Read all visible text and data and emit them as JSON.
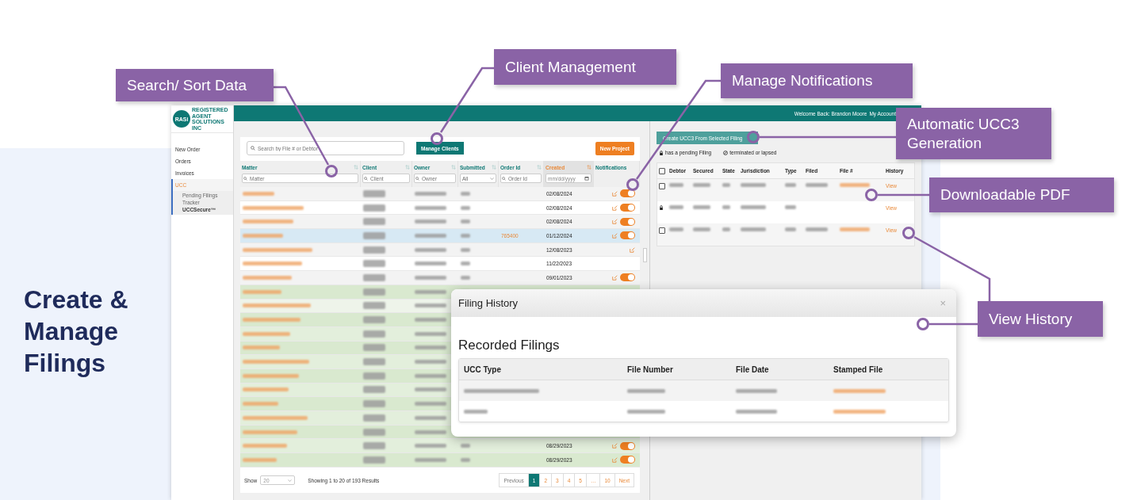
{
  "headline": "Create & Manage Filings",
  "callouts": [
    {
      "text": "Search/ Sort Data"
    },
    {
      "text": "Client Management"
    },
    {
      "text": "Manage Notifications"
    },
    {
      "text": "Automatic UCC3 Generation"
    },
    {
      "text": "Downloadable PDF"
    },
    {
      "text": "View History"
    }
  ],
  "app": {
    "logo": {
      "mark": "RASi",
      "line_1": "REGISTERED AGENT",
      "line_2": "SOLUTIONS INC"
    },
    "nav": [
      {
        "label": "New Order",
        "selected": false
      },
      {
        "label": "Orders",
        "selected": false
      },
      {
        "label": "Invoices",
        "selected": false
      },
      {
        "label": "UCC",
        "selected": true,
        "children": [
          {
            "label": "Pending Filings Tracker",
            "selected": false
          },
          {
            "label": "UCCSecure™",
            "selected": true
          }
        ]
      }
    ],
    "top_bar": {
      "welcome": "Welcome Back: Brandon Moore",
      "account_link": "My Account"
    },
    "orders": {
      "search": {
        "placeholder": "Search by File # or Debtor"
      },
      "manage_button": "Manage Clients",
      "new_button": "New Project",
      "columns": [
        {
          "label": "Matter",
          "sortable": true,
          "sorted": false
        },
        {
          "label": "Client",
          "sortable": true,
          "sorted": false
        },
        {
          "label": "Owner",
          "sortable": true,
          "sorted": false
        },
        {
          "label": "Submitted",
          "sortable": true,
          "sorted": false
        },
        {
          "label": "Order Id",
          "sortable": true,
          "sorted": false
        },
        {
          "label": "Created",
          "sortable": true,
          "sorted": true
        },
        {
          "label": "Notifications",
          "sortable": false,
          "sorted": false
        }
      ],
      "filters": [
        {
          "kind": "text",
          "placeholder": "Matter"
        },
        {
          "kind": "text",
          "placeholder": "Client"
        },
        {
          "kind": "text",
          "placeholder": "Owner"
        },
        {
          "kind": "select",
          "value": "All"
        },
        {
          "kind": "text",
          "placeholder": "Order Id"
        },
        {
          "kind": "date",
          "placeholder": "mm/dd/yyyy"
        },
        {
          "kind": "none"
        }
      ],
      "rows": [
        {
          "color": "#f3f3f3",
          "created": "02/08/2024",
          "edit": true,
          "toggle": true
        },
        {
          "color": "#ffffff",
          "created": "02/08/2024",
          "edit": true,
          "toggle": true
        },
        {
          "color": "#f3f3f3",
          "created": "02/08/2024",
          "edit": true,
          "toggle": true
        },
        {
          "color": "#d7e9f4",
          "order_id": "765400",
          "created": "01/12/2024",
          "edit": true,
          "toggle": true
        },
        {
          "color": "#f3f3f3",
          "created": "12/08/2023",
          "edit": true,
          "toggle": false
        },
        {
          "color": "#ffffff",
          "created": "11/22/2023",
          "edit": false,
          "toggle": false
        },
        {
          "color": "#f3f3f3",
          "created": "09/01/2023",
          "edit": true,
          "toggle": true
        },
        {
          "color": "#d9e9cf"
        },
        {
          "color": "#eef4ea"
        },
        {
          "color": "#d9e9cf"
        },
        {
          "color": "#e3efdc"
        },
        {
          "color": "#d9e9cf"
        },
        {
          "color": "#e3efdc"
        },
        {
          "color": "#d9e9cf"
        },
        {
          "color": "#e3efdc"
        },
        {
          "color": "#d9e9cf"
        },
        {
          "color": "#e3efdc"
        },
        {
          "color": "#d9e9cf"
        },
        {
          "color": "#e3efdc",
          "created": "08/29/2023",
          "edit": true,
          "toggle": true
        },
        {
          "color": "#d9e9cf",
          "created": "08/29/2023",
          "edit": true,
          "toggle": true
        }
      ],
      "footer": {
        "show_label": "Show",
        "page_size": "20",
        "summary": "Showing 1 to 20 of 193 Results",
        "pages": [
          {
            "label": "Previous",
            "selected": false
          },
          {
            "label": "1",
            "selected": true
          },
          {
            "label": "2",
            "selected": false
          },
          {
            "label": "3",
            "selected": false
          },
          {
            "label": "4",
            "selected": false
          },
          {
            "label": "5",
            "selected": false
          },
          {
            "label": "…",
            "selected": false
          },
          {
            "label": "10",
            "selected": false
          },
          {
            "label": "Next",
            "selected": false
          }
        ]
      }
    },
    "filings": {
      "create_button": "Create UCC3 From Selected Filing",
      "legend": [
        {
          "kind": "lock",
          "text": "has a pending Filing"
        },
        {
          "kind": "ban",
          "text": "terminated or lapsed"
        }
      ],
      "select_all": {
        "checked": false
      },
      "columns": [
        "Debtor",
        "Secured",
        "State",
        "Jurisdiction",
        "Type",
        "Filed",
        "File #",
        "History"
      ],
      "rows": [
        {
          "kind": "checkbox",
          "checked": false,
          "has_file": true,
          "history": "View"
        },
        {
          "kind": "lock",
          "has_file": false,
          "history": "View"
        },
        {
          "kind": "checkbox",
          "checked": false,
          "has_file": true,
          "history": "View"
        }
      ]
    },
    "modal": {
      "title": "Filing History",
      "close": "×",
      "heading": "Recorded Filings",
      "columns": [
        "UCC Type",
        "File Number",
        "File Date",
        "Stamped File"
      ],
      "rows": [
        {
          "kind": "blurred"
        },
        {
          "kind": "blurred"
        }
      ]
    }
  }
}
